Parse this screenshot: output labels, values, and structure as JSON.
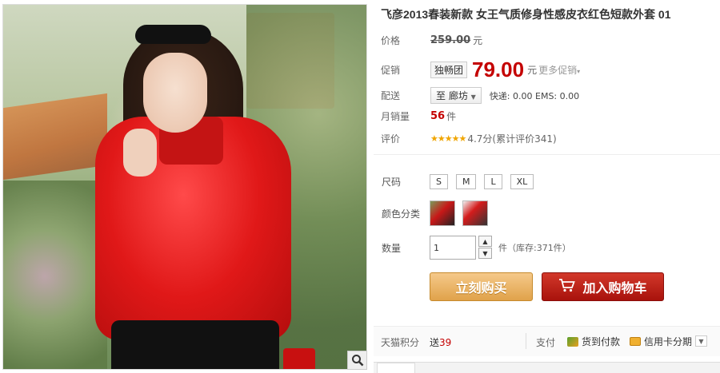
{
  "product": {
    "title": "飞彦2013春装新款 女王气质修身性感皮衣红色短款外套 01"
  },
  "price": {
    "label": "价格",
    "original": "259.00",
    "unit": "元"
  },
  "promotion": {
    "label": "促销",
    "tag": "独畅团",
    "price": "79.00",
    "unit": "元",
    "more": "更多促销"
  },
  "shipping": {
    "label": "配送",
    "destination": "至 廊坊",
    "info": "快递: 0.00 EMS: 0.00"
  },
  "monthly_sales": {
    "label": "月销量",
    "count": "56",
    "unit": "件"
  },
  "rating": {
    "label": "评价",
    "stars": "★★★★★",
    "score": "4.7分(累计评价341)"
  },
  "sku": {
    "size_label": "尺码",
    "sizes": [
      "S",
      "M",
      "L",
      "XL"
    ],
    "color_label": "颜色分类",
    "quantity_label": "数量",
    "quantity_value": "1",
    "stock": "件（库存:371件）"
  },
  "buttons": {
    "buy": "立刻购买",
    "cart": "加入购物车"
  },
  "footer": {
    "points_label": "天猫积分",
    "points_prefix": "送",
    "points_value": "39",
    "pay_label": "支付",
    "cod": "货到付款",
    "credit": "信用卡分期"
  },
  "colors": {
    "accent": "#c40000",
    "buy_button": "#e0a24a",
    "cart_button": "#a8120c"
  }
}
